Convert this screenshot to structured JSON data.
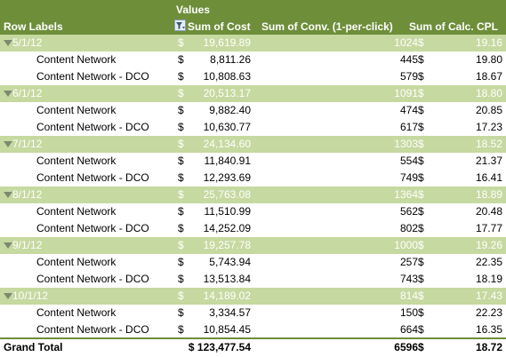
{
  "header": {
    "values_caption": "Values",
    "row_labels": "Row Labels",
    "sum_of_cost": "Sum of Cost",
    "sum_of_conv": "Sum of Conv. (1-per-click)",
    "sum_of_cpl": "Sum of Calc. CPL"
  },
  "currency": "$",
  "groups": [
    {
      "date": "5/1/12",
      "cost": "19,619.89",
      "conv": "1024",
      "cpl": "19.16",
      "rows": [
        {
          "label": "Content Network",
          "cost": "8,811.26",
          "conv": "445",
          "cpl": "19.80"
        },
        {
          "label": "Content Network - DCO",
          "cost": "10,808.63",
          "conv": "579",
          "cpl": "18.67"
        }
      ]
    },
    {
      "date": "6/1/12",
      "cost": "20,513.17",
      "conv": "1091",
      "cpl": "18.80",
      "rows": [
        {
          "label": "Content Network",
          "cost": "9,882.40",
          "conv": "474",
          "cpl": "20.85"
        },
        {
          "label": "Content Network - DCO",
          "cost": "10,630.77",
          "conv": "617",
          "cpl": "17.23"
        }
      ]
    },
    {
      "date": "7/1/12",
      "cost": "24,134.60",
      "conv": "1303",
      "cpl": "18.52",
      "rows": [
        {
          "label": "Content Network",
          "cost": "11,840.91",
          "conv": "554",
          "cpl": "21.37"
        },
        {
          "label": "Content Network - DCO",
          "cost": "12,293.69",
          "conv": "749",
          "cpl": "16.41"
        }
      ]
    },
    {
      "date": "8/1/12",
      "cost": "25,763.08",
      "conv": "1364",
      "cpl": "18.89",
      "rows": [
        {
          "label": "Content Network",
          "cost": "11,510.99",
          "conv": "562",
          "cpl": "20.48"
        },
        {
          "label": "Content Network - DCO",
          "cost": "14,252.09",
          "conv": "802",
          "cpl": "17.77"
        }
      ]
    },
    {
      "date": "9/1/12",
      "cost": "19,257.78",
      "conv": "1000",
      "cpl": "19.26",
      "rows": [
        {
          "label": "Content Network",
          "cost": "5,743.94",
          "conv": "257",
          "cpl": "22.35"
        },
        {
          "label": "Content Network - DCO",
          "cost": "13,513.84",
          "conv": "743",
          "cpl": "18.19"
        }
      ]
    },
    {
      "date": "10/1/12",
      "cost": "14,189.02",
      "conv": "814",
      "cpl": "17.43",
      "rows": [
        {
          "label": "Content Network",
          "cost": "3,334.57",
          "conv": "150",
          "cpl": "22.23"
        },
        {
          "label": "Content Network - DCO",
          "cost": "10,854.45",
          "conv": "664",
          "cpl": "16.35"
        }
      ]
    }
  ],
  "grand_total": {
    "label": "Grand Total",
    "cost": "$ 123,477.54",
    "conv": "6596",
    "cpl": "18.72"
  },
  "colors": {
    "header_bg": "#6e8e3a",
    "group_bg": "#c6d9a0",
    "group_text": "#ffffff"
  },
  "icons": {
    "filter": "filter-icon",
    "collapse": "collapse-triangle-icon"
  }
}
